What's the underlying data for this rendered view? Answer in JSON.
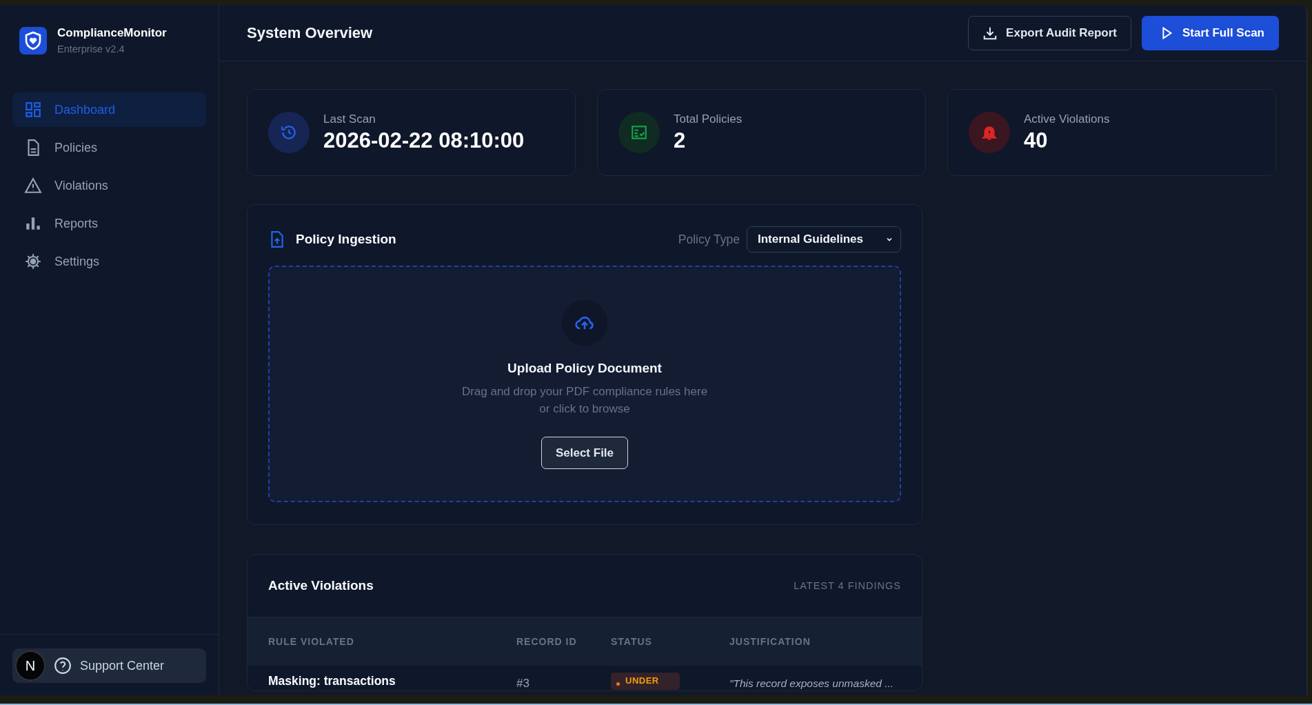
{
  "sidebar": {
    "brand": {
      "name": "ComplianceMonitor",
      "edition": "Enterprise v2.4"
    },
    "items": [
      {
        "label": "Dashboard",
        "selected": true
      },
      {
        "label": "Policies",
        "selected": false
      },
      {
        "label": "Violations",
        "selected": false
      },
      {
        "label": "Reports",
        "selected": false
      },
      {
        "label": "Settings",
        "selected": false
      }
    ],
    "avatar": "N",
    "support": "Support Center"
  },
  "header": {
    "title": "System Overview",
    "buttons": [
      {
        "label": "Export Audit Report",
        "kind": "secondary"
      },
      {
        "label": "Start Full Scan",
        "kind": "primary"
      }
    ]
  },
  "stats": [
    {
      "label": "Last Scan",
      "value": "2026-02-22 08:10:00"
    },
    {
      "label": "Total Policies",
      "value": "2"
    },
    {
      "label": "Active Violations",
      "value": "40"
    }
  ],
  "ingestion": {
    "title": "Policy Ingestion",
    "policy_type_label": "Policy Type",
    "policy_type": "Internal Guidelines",
    "upload_title": "Upload Policy Document",
    "upload_hint": [
      "Drag and drop your PDF compliance rules here",
      "or click to browse"
    ],
    "button": "Select File"
  },
  "violations": {
    "title": "Active Violations",
    "count": "LATEST 4 FINDINGS",
    "columns": [
      "RULE VIOLATED",
      "RECORD ID",
      "STATUS",
      "JUSTIFICATION"
    ],
    "rows": [
      {
        "rule": "Masking: transactions",
        "record": "#3",
        "status": {
          "label": "UNDER",
          "color": "#f97316"
        },
        "justification": "\"This record exposes unmasked ..."
      }
    ]
  }
}
